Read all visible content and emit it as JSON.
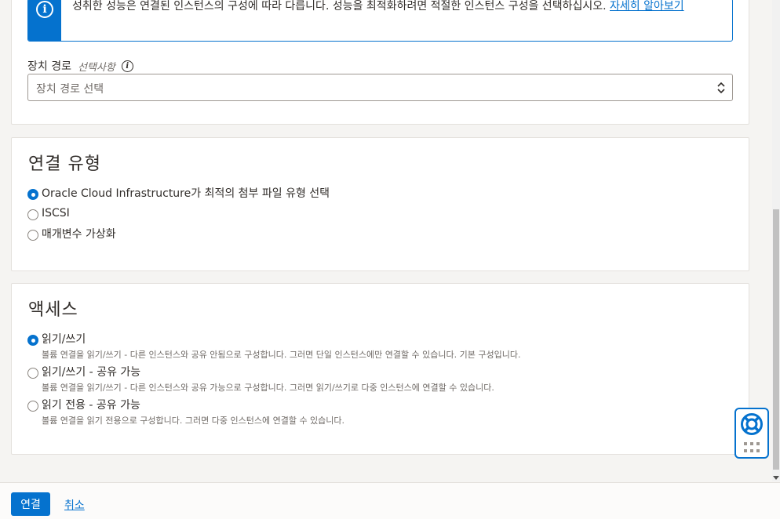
{
  "banner": {
    "text": "성취한 성능은 연결된 인스턴스의 구성에 따라 다릅니다. 성능을 최적화하려면 적절한 인스턴스 구성을 선택하십시오. ",
    "link": "자세히 알아보기",
    "icon": "info-icon"
  },
  "device_path": {
    "label": "장치 경로",
    "optional": "선택사항",
    "placeholder": "장치 경로 선택"
  },
  "attachment_type": {
    "title": "연결 유형",
    "options": [
      {
        "label": "Oracle Cloud Infrastructure가 최적의 첨부 파일 유형 선택",
        "checked": true
      },
      {
        "label": "ISCSI",
        "checked": false
      },
      {
        "label": "매개변수 가상화",
        "checked": false
      }
    ]
  },
  "access": {
    "title": "액세스",
    "options": [
      {
        "label": "읽기/쓰기",
        "desc": "볼륨 연결을 읽기/쓰기 - 다른 인스턴스와 공유 안됨으로 구성합니다. 그러면 단일 인스턴스에만 연결할 수 있습니다. 기본 구성입니다.",
        "checked": true
      },
      {
        "label": "읽기/쓰기 - 공유 가능",
        "desc": "볼륨 연결을 읽기/쓰기 - 다른 인스턴스와 공유 가능으로 구성합니다. 그러면 읽기/쓰기로 다중 인스턴스에 연결할 수 있습니다.",
        "checked": false
      },
      {
        "label": "읽기 전용 - 공유 가능",
        "desc": "볼륨 연결을 읽기 전용으로 구성합니다. 그러면 다중 인스턴스에 연결할 수 있습니다.",
        "checked": false
      }
    ]
  },
  "footer": {
    "attach_label": "연결",
    "cancel_label": "취소"
  },
  "colors": {
    "accent": "#0572ce",
    "text": "#312d2a",
    "muted": "#6f6a66"
  }
}
